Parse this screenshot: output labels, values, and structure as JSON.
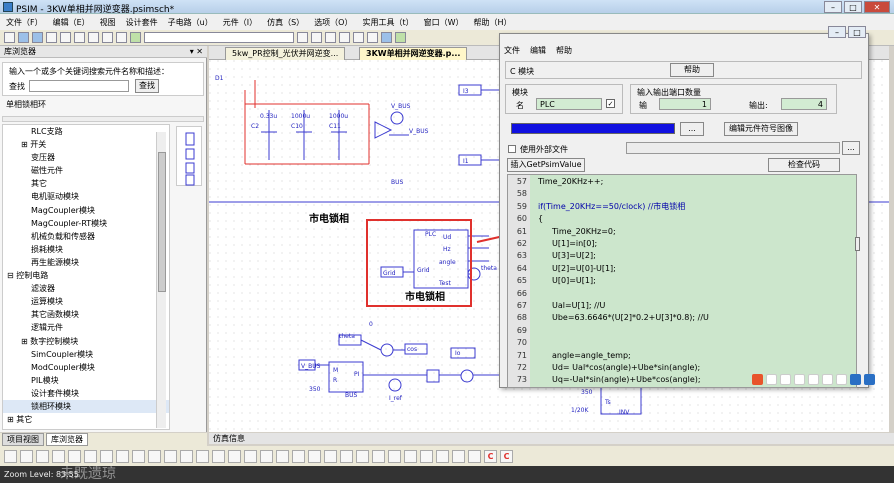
{
  "window": {
    "title": "PSIM - 3KW单相并网逆变器.psimsch*"
  },
  "menu": [
    "文件（F）",
    "编辑（E）",
    "视图",
    "设计套件",
    "子电路（u）",
    "元件（I）",
    "仿真（S）",
    "选项（O）",
    "实用工具（t）",
    "窗口（W）",
    "帮助（H）"
  ],
  "library": {
    "header": "库浏览器",
    "prompt": "输入一个或多个关键词搜索元件名称和描述：",
    "find_label": "查找",
    "find_button": "查找",
    "search_value": "",
    "selection": "单相锁相环",
    "tree": [
      "RLC支路",
      "⊞ 开关",
      "变压器",
      "磁性元件",
      "其它",
      "电机驱动模块",
      "MagCoupler模块",
      "MagCoupler-RT模块",
      "机械负载和传感器",
      "损耗模块",
      "再生能源模块",
      "⊟ 控制电路",
      "滤波器",
      "运算模块",
      "其它函数模块",
      "逻辑元件",
      "⊞ 数字控制模块",
      "SimCoupler模块",
      "ModCoupler模块",
      "PIL模块",
      "设计套件模块",
      "锁相环模块",
      "⊞ 其它"
    ],
    "tabs": [
      "项目视图",
      "库浏览器"
    ]
  },
  "doc_tabs": [
    "5kw_PR控制_光伏并网逆变...",
    "3KW单相并网逆变器.p..."
  ],
  "schematic": {
    "label_grid_lock": "市电锁相",
    "label_grid_lock2": "市电锁相",
    "pll_title": "PLC",
    "pll_ports": [
      "Ud",
      "Hz",
      "angle",
      "Test"
    ],
    "pll_input": "Grid",
    "grid_tag": "Grid",
    "caps": [
      "0.33u\nC2",
      "1000u\nC10",
      "1000u\nC11"
    ],
    "vbus_labels": [
      "V_BUS",
      "V_BUS",
      "BUS",
      "V_BUS",
      "BUS"
    ],
    "nodes": [
      "I3",
      "I1"
    ],
    "theta": "theta",
    "cos": "cos",
    "io": "Io",
    "iref": "I_ref",
    "num350": "350",
    "num350b": "350",
    "num0": "0",
    "ts": "Ts",
    "inv": "INV",
    "div": "1/20K",
    "d1": "D1",
    "pi": "PI",
    "mr": [
      "M",
      "R"
    ],
    "theta_tag": "theta"
  },
  "dialog": {
    "title": "C 模块",
    "menu": [
      "文件",
      "编辑",
      "帮助"
    ],
    "help_button": "帮助",
    "module_label": "模块",
    "name_label": "名",
    "name_value": "PLC",
    "io_group": "输入输出端口数量",
    "input_label": "输",
    "input_value": "1",
    "output_label": "输出:",
    "output_value": "4",
    "browse_button": "...",
    "edit_symbol_button": "编辑元件符号图像",
    "external_file_label": "使用外部文件",
    "external_browse": "...",
    "insert_button": "插入GetPsimValue",
    "check_button": "检查代码",
    "code": [
      {
        "n": "57",
        "t": "Time_20KHz++;"
      },
      {
        "n": "58",
        "t": ""
      },
      {
        "n": "59",
        "t": "if(Time_20KHz==50/clock) //市电锁相"
      },
      {
        "n": "60",
        "t": "{"
      },
      {
        "n": "61",
        "t": "Time_20KHz=0;"
      },
      {
        "n": "62",
        "t": "U[1]=in[0];"
      },
      {
        "n": "63",
        "t": "U[3]=U[2];"
      },
      {
        "n": "64",
        "t": "U[2]=U[0]-U[1];"
      },
      {
        "n": "65",
        "t": "U[0]=U[1];"
      },
      {
        "n": "66",
        "t": ""
      },
      {
        "n": "67",
        "t": "Ual=U[1];                    //U"
      },
      {
        "n": "68",
        "t": "Ube=63.6646*(U[2]*0.2+U[3]*0.8);    //U"
      },
      {
        "n": "69",
        "t": ""
      },
      {
        "n": "70",
        "t": ""
      },
      {
        "n": "71",
        "t": "angle=angle_temp;"
      },
      {
        "n": "72",
        "t": "Ud= Ual*cos(angle)+Ube*sin(angle);"
      },
      {
        "n": "73",
        "t": "Uq=-Ual*sin(angle)+Ube*cos(angle);"
      }
    ]
  },
  "sim_info": "仿真信息",
  "status": "Zoom Level: 83.55",
  "watermark": "未既遗琼",
  "colors": {
    "red": "#e0312d",
    "blue": "#1f1fbf",
    "wire": "#3b3bd0",
    "code_bg": "#cce6cc"
  }
}
